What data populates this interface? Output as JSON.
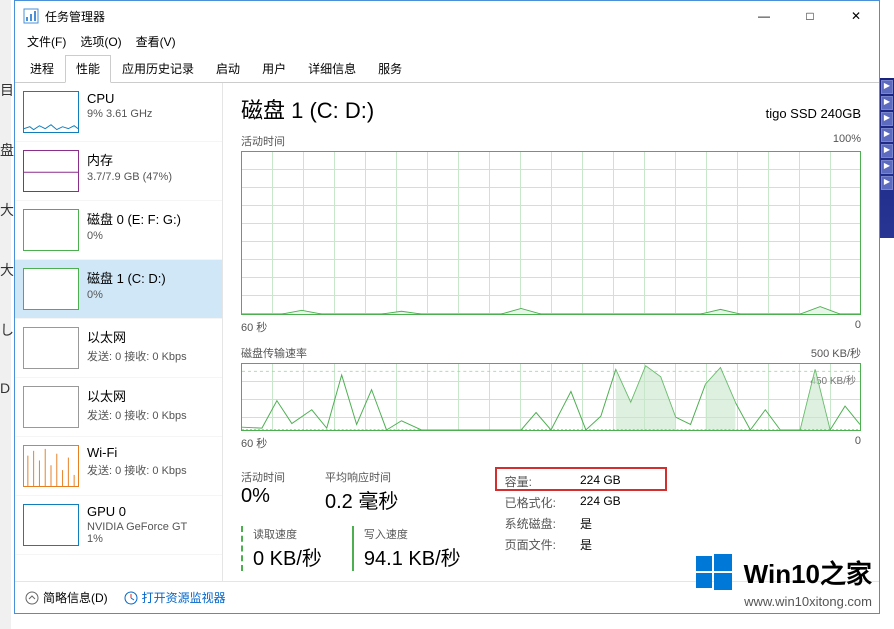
{
  "window": {
    "title": "任务管理器",
    "menu": {
      "file": "文件(F)",
      "options": "选项(O)",
      "view": "查看(V)"
    },
    "controls": {
      "min": "—",
      "max": "□",
      "close": "✕"
    }
  },
  "tabs": [
    "进程",
    "性能",
    "应用历史记录",
    "启动",
    "用户",
    "详细信息",
    "服务"
  ],
  "active_tab": 1,
  "sidebar": {
    "items": [
      {
        "title": "CPU",
        "sub": "9% 3.61 GHz",
        "type": "cpu"
      },
      {
        "title": "内存",
        "sub": "3.7/7.9 GB (47%)",
        "type": "mem"
      },
      {
        "title": "磁盘 0 (E: F: G:)",
        "sub": "0%",
        "type": "disk"
      },
      {
        "title": "磁盘 1 (C: D:)",
        "sub": "0%",
        "type": "disk",
        "selected": true
      },
      {
        "title": "以太网",
        "sub": "发送: 0 接收: 0 Kbps",
        "type": "eth"
      },
      {
        "title": "以太网",
        "sub": "发送: 0 接收: 0 Kbps",
        "type": "eth"
      },
      {
        "title": "Wi-Fi",
        "sub": "发送: 0 接收: 0 Kbps",
        "type": "wifi"
      },
      {
        "title": "GPU 0",
        "sub": "NVIDIA GeForce GT",
        "sub2": "1%",
        "type": "gpu"
      }
    ]
  },
  "main": {
    "title": "磁盘 1 (C: D:)",
    "model": "tigo SSD 240GB",
    "chart1": {
      "label": "活动时间",
      "max": "100%",
      "xleft": "60 秒",
      "xright": "0"
    },
    "chart2": {
      "label": "磁盘传输速率",
      "max": "500 KB/秒",
      "inner": "450 KB/秒",
      "xleft": "60 秒",
      "xright": "0"
    },
    "stats": {
      "active_time": {
        "label": "活动时间",
        "value": "0%"
      },
      "avg_response": {
        "label": "平均响应时间",
        "value": "0.2 毫秒"
      },
      "read_speed": {
        "label": "读取速度",
        "value": "0 KB/秒"
      },
      "write_speed": {
        "label": "写入速度",
        "value": "94.1 KB/秒"
      }
    },
    "info": {
      "capacity": {
        "label": "容量:",
        "value": "224 GB"
      },
      "formatted": {
        "label": "已格式化:",
        "value": "224 GB"
      },
      "system_disk": {
        "label": "系统磁盘:",
        "value": "是"
      },
      "page_file": {
        "label": "页面文件:",
        "value": "是"
      }
    }
  },
  "footer": {
    "simple": "简略信息(D)",
    "resmon": "打开资源监视器"
  },
  "watermark": {
    "title": "Win10之家",
    "url": "www.win10xitong.com"
  },
  "chart_data": [
    {
      "type": "line",
      "title": "活动时间",
      "xlabel": "秒",
      "ylabel": "%",
      "xlim": [
        0,
        60
      ],
      "ylim": [
        0,
        100
      ],
      "x_reversed": true,
      "series": [
        {
          "name": "活动时间 %",
          "values": [
            0,
            0,
            0,
            0,
            2,
            0,
            0,
            0,
            0,
            1,
            0,
            0,
            3,
            0,
            0,
            0,
            0,
            0,
            0,
            0,
            0,
            4,
            0,
            0,
            0,
            0,
            0,
            0,
            0,
            0,
            0,
            0,
            0,
            0,
            0,
            0,
            0,
            2,
            0,
            0,
            0,
            0,
            0,
            0,
            0,
            5,
            0,
            0,
            0,
            0,
            0,
            0,
            0,
            0,
            3,
            0,
            0,
            0,
            0,
            0,
            0
          ]
        }
      ]
    },
    {
      "type": "line",
      "title": "磁盘传输速率",
      "xlabel": "秒",
      "ylabel": "KB/秒",
      "xlim": [
        0,
        60
      ],
      "ylim": [
        0,
        500
      ],
      "x_reversed": true,
      "annotations": [
        "450 KB/秒"
      ],
      "series": [
        {
          "name": "读取",
          "values": [
            0,
            0,
            0,
            0,
            0,
            0,
            0,
            0,
            0,
            0,
            0,
            0,
            0,
            0,
            0,
            0,
            0,
            0,
            0,
            0,
            0,
            0,
            0,
            0,
            0,
            0,
            0,
            0,
            0,
            0,
            0,
            0,
            0,
            0,
            0,
            0,
            0,
            0,
            0,
            0,
            0,
            0,
            0,
            0,
            0,
            0,
            0,
            0,
            0,
            0,
            0,
            0,
            0,
            0,
            0,
            0,
            0,
            0,
            0,
            0,
            0
          ]
        },
        {
          "name": "写入",
          "values": [
            20,
            10,
            0,
            200,
            50,
            0,
            150,
            20,
            0,
            420,
            30,
            300,
            0,
            60,
            0,
            10,
            0,
            0,
            0,
            0,
            0,
            0,
            0,
            0,
            0,
            0,
            130,
            0,
            0,
            0,
            0,
            300,
            0,
            0,
            100,
            460,
            200,
            490,
            400,
            100,
            0,
            50,
            350,
            470,
            200,
            0,
            150,
            0,
            20,
            0,
            0,
            0,
            0,
            0,
            460,
            0,
            0,
            180,
            0,
            50,
            0
          ]
        }
      ]
    }
  ]
}
